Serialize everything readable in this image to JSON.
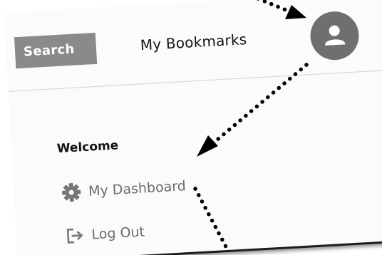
{
  "header": {
    "search_label": "Search",
    "title": "My Bookmarks",
    "avatar_icon": "user-icon"
  },
  "menu": {
    "welcome": "Welcome",
    "items": [
      {
        "label": "My Dashboard",
        "icon": "gear-icon"
      },
      {
        "label": "Log Out",
        "icon": "logout-icon"
      }
    ]
  },
  "colors": {
    "search_bg": "#8a8a8a",
    "avatar_bg": "#6f6f6f",
    "menu_text": "#6b6b6b",
    "arrows": "#000000"
  }
}
